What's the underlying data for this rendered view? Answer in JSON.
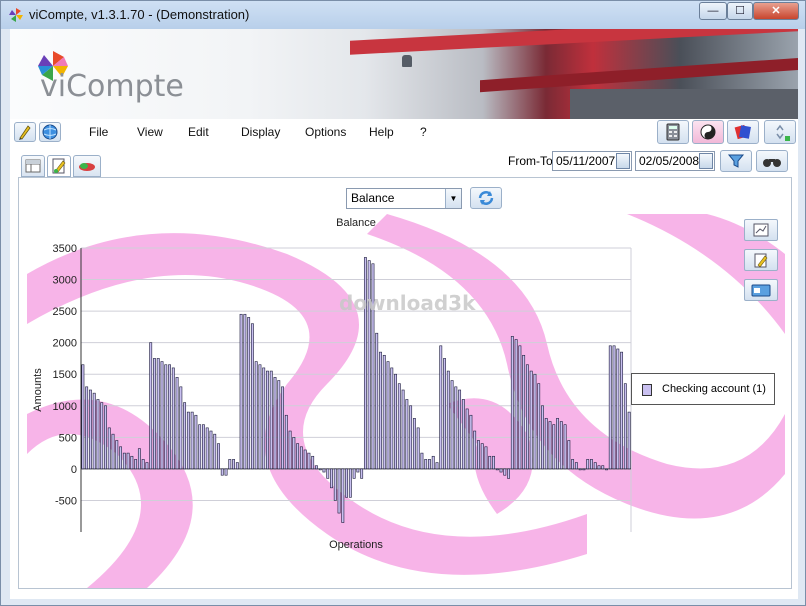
{
  "window": {
    "title": "viCompte, v1.3.1.70 - (Demonstration)",
    "min_glyph": "—",
    "max_glyph": "☐",
    "close_glyph": "✕"
  },
  "banner": {
    "logo_text": "viCompte"
  },
  "menu": {
    "items": [
      "File",
      "View",
      "Edit",
      "Display",
      "Options",
      "Help",
      "?"
    ]
  },
  "filter": {
    "label": "From-To",
    "from": "05/11/2007",
    "to": "02/05/2008"
  },
  "chart_select": {
    "value": "Balance"
  },
  "watermark": "download3k",
  "icons": {
    "app": "pinwheel-icon",
    "menu_left": [
      "edit-pencil-icon",
      "globe-icon"
    ],
    "toolbar_right": [
      "calculator-icon",
      "yin-yang-icon",
      "color-books-icon",
      "sort-arrows-icon"
    ],
    "subtabs": [
      "table-icon",
      "edit-document-icon",
      "chart-pill-icon"
    ],
    "filter": [
      "funnel-icon",
      "binoculars-icon"
    ],
    "chart_side": [
      "chart-frame-icon",
      "edit-note-icon",
      "card-icon"
    ]
  },
  "colors": {
    "bar_fill": "#c9c0f0",
    "bar_stroke": "#1a1a3a",
    "background_swirl": "#f49be0"
  },
  "chart_data": {
    "type": "bar",
    "title": "Balance",
    "xlabel": "Operations",
    "ylabel": "Amounts",
    "ylim": [
      -1000,
      3500
    ],
    "yticks": [
      3500,
      3000,
      2500,
      2000,
      1500,
      1000,
      500,
      0,
      -500
    ],
    "grid": true,
    "legend_position": "right",
    "series": [
      {
        "name": "Checking account (1)",
        "values": [
          1650,
          1300,
          1250,
          1200,
          1100,
          1050,
          1000,
          650,
          550,
          450,
          350,
          250,
          250,
          200,
          150,
          320,
          150,
          100,
          2000,
          1750,
          1750,
          1700,
          1650,
          1650,
          1600,
          1450,
          1300,
          1050,
          900,
          900,
          850,
          700,
          700,
          650,
          600,
          550,
          400,
          -100,
          -100,
          150,
          150,
          100,
          2450,
          2450,
          2400,
          2300,
          1700,
          1650,
          1600,
          1550,
          1550,
          1450,
          1400,
          1300,
          850,
          600,
          500,
          400,
          350,
          300,
          250,
          200,
          50,
          0,
          -50,
          -150,
          -300,
          -500,
          -700,
          -850,
          -450,
          -450,
          -150,
          -50,
          -150,
          3350,
          3300,
          3250,
          2150,
          1850,
          1800,
          1700,
          1600,
          1500,
          1350,
          1250,
          1100,
          1000,
          800,
          650,
          250,
          150,
          150,
          200,
          100,
          1950,
          1750,
          1550,
          1400,
          1300,
          1250,
          1100,
          950,
          850,
          600,
          450,
          400,
          350,
          200,
          200,
          0,
          -50,
          -100,
          -150,
          2100,
          2050,
          1950,
          1800,
          1650,
          1550,
          1500,
          1350,
          1000,
          800,
          750,
          700,
          800,
          750,
          700,
          450,
          150,
          100,
          0,
          0,
          150,
          150,
          100,
          50,
          50,
          0,
          1950,
          1950,
          1900,
          1850,
          1350,
          900
        ]
      }
    ]
  }
}
